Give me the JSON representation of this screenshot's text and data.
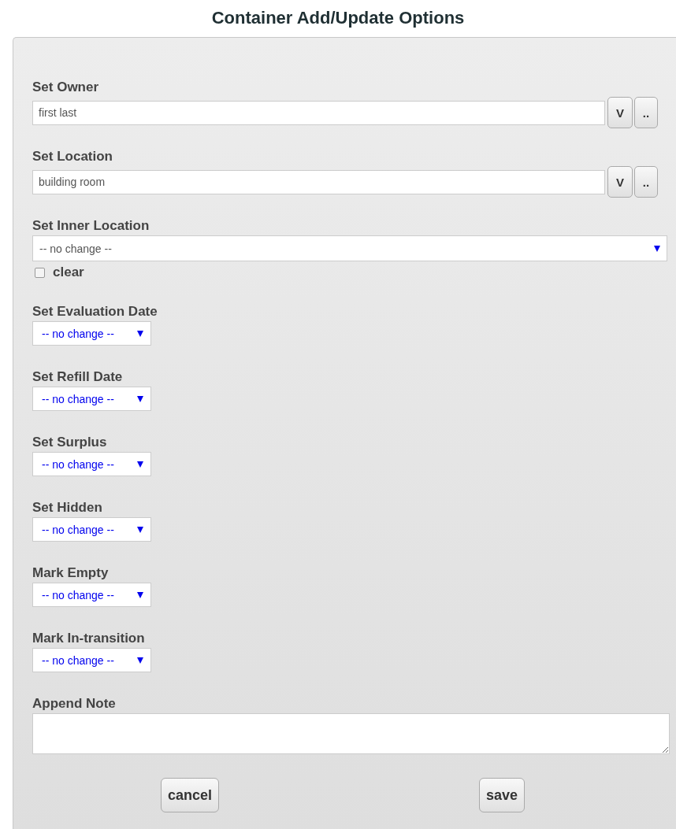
{
  "title": "Container Add/Update Options",
  "lookups": [
    {
      "label": "Set Owner",
      "value": "first last",
      "buttons": [
        "V",
        ".."
      ]
    },
    {
      "label": "Set Location",
      "value": "building room",
      "buttons": [
        "V",
        ".."
      ]
    }
  ],
  "inner_location": {
    "label": "Set Inner Location",
    "value": "-- no change --",
    "clear": {
      "label": "clear",
      "checked": false
    }
  },
  "selects": [
    {
      "label": "Set Evaluation Date",
      "value": "-- no change --"
    },
    {
      "label": "Set Refill Date",
      "value": "-- no change --"
    },
    {
      "label": "Set Surplus",
      "value": "-- no change --"
    },
    {
      "label": "Set Hidden",
      "value": "-- no change --"
    },
    {
      "label": "Mark Empty",
      "value": "-- no change --"
    },
    {
      "label": "Mark In-transition",
      "value": "-- no change --"
    }
  ],
  "note": {
    "label": "Append Note"
  },
  "buttons": [
    "cancel",
    "save"
  ]
}
